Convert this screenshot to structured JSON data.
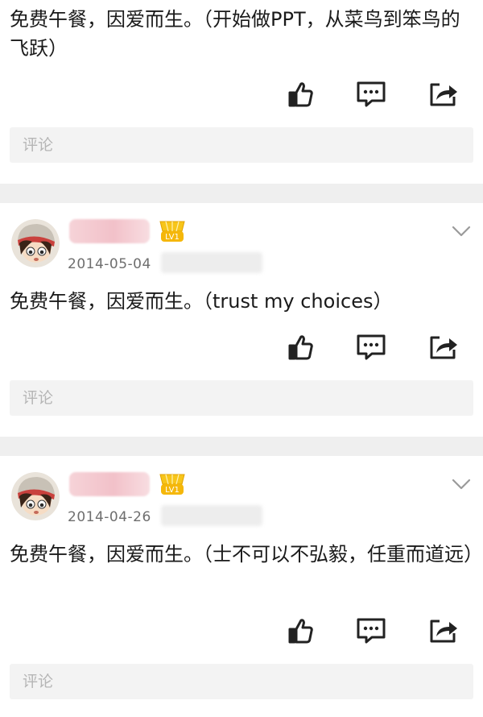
{
  "posts": [
    {
      "text": "免费午餐，因爱而生。（开始做PPT，从菜鸟到笨鸟的飞跃）",
      "comment_placeholder": "评论"
    },
    {
      "date": "2014-05-04",
      "badge": "LV1",
      "text": "免费午餐，因爱而生。（trust my choices）",
      "comment_placeholder": "评论"
    },
    {
      "date": "2014-04-26",
      "badge": "LV1",
      "text": "免费午餐，因爱而生。（士不可以不弘毅，任重而道远）",
      "comment_placeholder": "评论"
    }
  ],
  "colors": {
    "separator": "#efefef",
    "comment_box_bg": "#f3f3f3",
    "badge_gold": "#f5b70a"
  },
  "icons": [
    "like-icon",
    "comment-icon",
    "share-icon",
    "chevron-down-icon"
  ]
}
